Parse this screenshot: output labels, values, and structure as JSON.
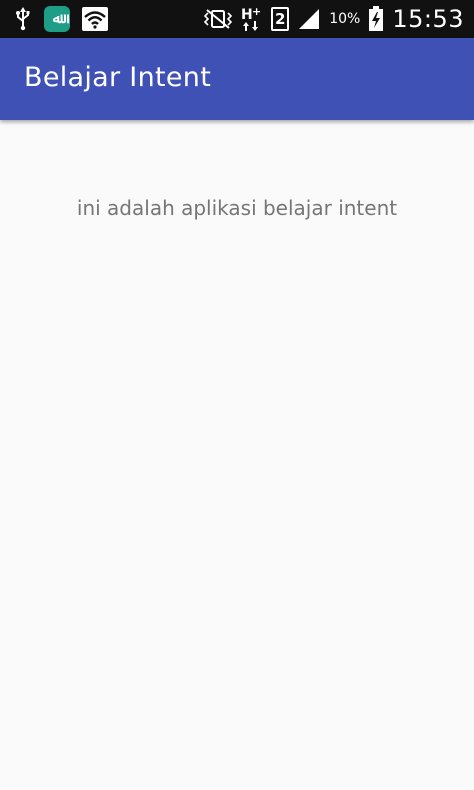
{
  "status_bar": {
    "icons": [
      "usb-icon",
      "app-badge-icon",
      "wifi-icon",
      "vibrate-icon",
      "network-hplus-icon",
      "sim-icon",
      "signal-icon",
      "battery-icon"
    ],
    "app_badge": "ﷲ",
    "sim_slot": "2",
    "battery_percent": "10%",
    "time": "15:53"
  },
  "app_bar": {
    "title": "Belajar Intent",
    "color": "#3f51b5"
  },
  "main": {
    "message": "ini adalah aplikasi belajar intent"
  }
}
